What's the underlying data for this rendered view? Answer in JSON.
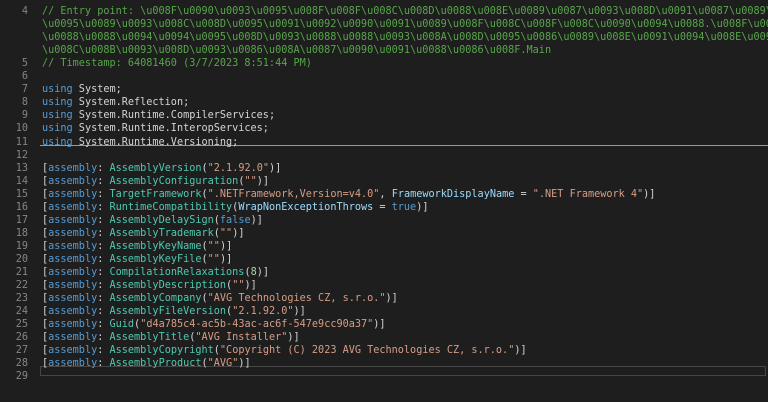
{
  "lines": [
    {
      "n": "4",
      "segs": [
        {
          "c": "comment",
          "t": "// Entry point: \\u008F\\u0090\\u0093\\u0095\\u008F\\u008F\\u008C\\u008D\\u0088\\u008E\\u0089\\u0087\\u0093\\u008D\\u0091\\u0087\\u0089\\u0094"
        }
      ]
    },
    {
      "n": "",
      "segs": [
        {
          "c": "comment",
          "t": "\\u0095\\u0089\\u0093\\u008C\\u008D\\u0095\\u0091\\u0092\\u0090\\u0091\\u0089\\u008F\\u008C\\u008F\\u008C\\u0090\\u0094\\u0088.\\u008F\\u0092"
        }
      ]
    },
    {
      "n": "",
      "segs": [
        {
          "c": "comment",
          "t": "\\u0088\\u0088\\u0094\\u0094\\u0095\\u008D\\u0093\\u0088\\u0088\\u0093\\u008A\\u008D\\u0095\\u0086\\u0089\\u008E\\u0091\\u0094\\u008E\\u0090"
        }
      ]
    },
    {
      "n": "",
      "segs": [
        {
          "c": "comment",
          "t": "\\u008C\\u008B\\u0093\\u008D\\u0093\\u0086\\u008A\\u0087\\u0090\\u0091\\u0088\\u0086\\u008F.Main"
        }
      ]
    },
    {
      "n": "5",
      "segs": [
        {
          "c": "comment",
          "t": "// Timestamp: 64081460 (3/7/2023 8:51:44 PM)"
        }
      ]
    },
    {
      "n": "6",
      "segs": []
    },
    {
      "n": "7",
      "segs": [
        {
          "c": "kw",
          "t": "using"
        },
        {
          "c": "ns",
          "t": " System;"
        }
      ]
    },
    {
      "n": "8",
      "segs": [
        {
          "c": "kw",
          "t": "using"
        },
        {
          "c": "ns",
          "t": " System.Reflection;"
        }
      ]
    },
    {
      "n": "9",
      "segs": [
        {
          "c": "kw",
          "t": "using"
        },
        {
          "c": "ns",
          "t": " System.Runtime.CompilerServices;"
        }
      ]
    },
    {
      "n": "10",
      "segs": [
        {
          "c": "kw",
          "t": "using"
        },
        {
          "c": "ns",
          "t": " System.Runtime.InteropServices;"
        }
      ]
    },
    {
      "n": "11",
      "segs": [
        {
          "c": "kw",
          "t": "using"
        },
        {
          "c": "ns",
          "t": " System.Runtime.Versioning;"
        }
      ]
    },
    {
      "n": "12",
      "segs": []
    },
    {
      "n": "13",
      "segs": [
        {
          "c": "punc",
          "t": "["
        },
        {
          "c": "attrkw",
          "t": "assembly"
        },
        {
          "c": "punc",
          "t": ": "
        },
        {
          "c": "attr",
          "t": "AssemblyVersion"
        },
        {
          "c": "punc",
          "t": "("
        },
        {
          "c": "str",
          "t": "\"2.1.92.0\""
        },
        {
          "c": "punc",
          "t": ")]"
        }
      ]
    },
    {
      "n": "14",
      "segs": [
        {
          "c": "punc",
          "t": "["
        },
        {
          "c": "attrkw",
          "t": "assembly"
        },
        {
          "c": "punc",
          "t": ": "
        },
        {
          "c": "attr",
          "t": "AssemblyConfiguration"
        },
        {
          "c": "punc",
          "t": "("
        },
        {
          "c": "str",
          "t": "\"\""
        },
        {
          "c": "punc",
          "t": ")]"
        }
      ]
    },
    {
      "n": "15",
      "segs": [
        {
          "c": "punc",
          "t": "["
        },
        {
          "c": "attrkw",
          "t": "assembly"
        },
        {
          "c": "punc",
          "t": ": "
        },
        {
          "c": "attr",
          "t": "TargetFramework"
        },
        {
          "c": "punc",
          "t": "("
        },
        {
          "c": "str",
          "t": "\".NETFramework,Version=v4.0\""
        },
        {
          "c": "punc",
          "t": ", "
        },
        {
          "c": "param",
          "t": "FrameworkDisplayName"
        },
        {
          "c": "punc",
          "t": " = "
        },
        {
          "c": "str",
          "t": "\".NET Framework 4\""
        },
        {
          "c": "punc",
          "t": ")]"
        }
      ]
    },
    {
      "n": "16",
      "segs": [
        {
          "c": "punc",
          "t": "["
        },
        {
          "c": "attrkw",
          "t": "assembly"
        },
        {
          "c": "punc",
          "t": ": "
        },
        {
          "c": "attr",
          "t": "RuntimeCompatibility"
        },
        {
          "c": "punc",
          "t": "("
        },
        {
          "c": "param",
          "t": "WrapNonExceptionThrows"
        },
        {
          "c": "punc",
          "t": " = "
        },
        {
          "c": "boolv",
          "t": "true"
        },
        {
          "c": "punc",
          "t": ")]"
        }
      ]
    },
    {
      "n": "17",
      "segs": [
        {
          "c": "punc",
          "t": "["
        },
        {
          "c": "attrkw",
          "t": "assembly"
        },
        {
          "c": "punc",
          "t": ": "
        },
        {
          "c": "attr",
          "t": "AssemblyDelaySign"
        },
        {
          "c": "punc",
          "t": "("
        },
        {
          "c": "boolv",
          "t": "false"
        },
        {
          "c": "punc",
          "t": ")]"
        }
      ]
    },
    {
      "n": "18",
      "segs": [
        {
          "c": "punc",
          "t": "["
        },
        {
          "c": "attrkw",
          "t": "assembly"
        },
        {
          "c": "punc",
          "t": ": "
        },
        {
          "c": "attr",
          "t": "AssemblyTrademark"
        },
        {
          "c": "punc",
          "t": "("
        },
        {
          "c": "str",
          "t": "\"\""
        },
        {
          "c": "punc",
          "t": ")]"
        }
      ]
    },
    {
      "n": "19",
      "segs": [
        {
          "c": "punc",
          "t": "["
        },
        {
          "c": "attrkw",
          "t": "assembly"
        },
        {
          "c": "punc",
          "t": ": "
        },
        {
          "c": "attr",
          "t": "AssemblyKeyName"
        },
        {
          "c": "punc",
          "t": "("
        },
        {
          "c": "str",
          "t": "\"\""
        },
        {
          "c": "punc",
          "t": ")]"
        }
      ]
    },
    {
      "n": "20",
      "segs": [
        {
          "c": "punc",
          "t": "["
        },
        {
          "c": "attrkw",
          "t": "assembly"
        },
        {
          "c": "punc",
          "t": ": "
        },
        {
          "c": "attr",
          "t": "AssemblyKeyFile"
        },
        {
          "c": "punc",
          "t": "("
        },
        {
          "c": "str",
          "t": "\"\""
        },
        {
          "c": "punc",
          "t": ")]"
        }
      ]
    },
    {
      "n": "21",
      "segs": [
        {
          "c": "punc",
          "t": "["
        },
        {
          "c": "attrkw",
          "t": "assembly"
        },
        {
          "c": "punc",
          "t": ": "
        },
        {
          "c": "attr",
          "t": "CompilationRelaxations"
        },
        {
          "c": "punc",
          "t": "("
        },
        {
          "c": "num",
          "t": "8"
        },
        {
          "c": "punc",
          "t": ")]"
        }
      ]
    },
    {
      "n": "22",
      "segs": [
        {
          "c": "punc",
          "t": "["
        },
        {
          "c": "attrkw",
          "t": "assembly"
        },
        {
          "c": "punc",
          "t": ": "
        },
        {
          "c": "attr",
          "t": "AssemblyDescription"
        },
        {
          "c": "punc",
          "t": "("
        },
        {
          "c": "str",
          "t": "\"\""
        },
        {
          "c": "punc",
          "t": ")]"
        }
      ]
    },
    {
      "n": "23",
      "segs": [
        {
          "c": "punc",
          "t": "["
        },
        {
          "c": "attrkw",
          "t": "assembly"
        },
        {
          "c": "punc",
          "t": ": "
        },
        {
          "c": "attr",
          "t": "AssemblyCompany"
        },
        {
          "c": "punc",
          "t": "("
        },
        {
          "c": "str",
          "t": "\"AVG Technologies CZ, s.r.o.\""
        },
        {
          "c": "punc",
          "t": ")]"
        }
      ]
    },
    {
      "n": "24",
      "segs": [
        {
          "c": "punc",
          "t": "["
        },
        {
          "c": "attrkw",
          "t": "assembly"
        },
        {
          "c": "punc",
          "t": ": "
        },
        {
          "c": "attr",
          "t": "AssemblyFileVersion"
        },
        {
          "c": "punc",
          "t": "("
        },
        {
          "c": "str",
          "t": "\"2.1.92.0\""
        },
        {
          "c": "punc",
          "t": ")]"
        }
      ]
    },
    {
      "n": "25",
      "segs": [
        {
          "c": "punc",
          "t": "["
        },
        {
          "c": "attrkw",
          "t": "assembly"
        },
        {
          "c": "punc",
          "t": ": "
        },
        {
          "c": "attr",
          "t": "Guid"
        },
        {
          "c": "punc",
          "t": "("
        },
        {
          "c": "str",
          "t": "\"d4a785c4-ac5b-43ac-ac6f-547e9cc90a37\""
        },
        {
          "c": "punc",
          "t": ")]"
        }
      ]
    },
    {
      "n": "26",
      "segs": [
        {
          "c": "punc",
          "t": "["
        },
        {
          "c": "attrkw",
          "t": "assembly"
        },
        {
          "c": "punc",
          "t": ": "
        },
        {
          "c": "attr",
          "t": "AssemblyTitle"
        },
        {
          "c": "punc",
          "t": "("
        },
        {
          "c": "str",
          "t": "\"AVG Installer\""
        },
        {
          "c": "punc",
          "t": ")]"
        }
      ]
    },
    {
      "n": "27",
      "segs": [
        {
          "c": "punc",
          "t": "["
        },
        {
          "c": "attrkw",
          "t": "assembly"
        },
        {
          "c": "punc",
          "t": ": "
        },
        {
          "c": "attr",
          "t": "AssemblyCopyright"
        },
        {
          "c": "punc",
          "t": "("
        },
        {
          "c": "str",
          "t": "\"Copyright (C) 2023 AVG Technologies CZ, s.r.o.\""
        },
        {
          "c": "punc",
          "t": ")]"
        }
      ]
    },
    {
      "n": "28",
      "segs": [
        {
          "c": "punc",
          "t": "["
        },
        {
          "c": "attrkw",
          "t": "assembly"
        },
        {
          "c": "punc",
          "t": ": "
        },
        {
          "c": "attr",
          "t": "AssemblyProduct"
        },
        {
          "c": "punc",
          "t": "("
        },
        {
          "c": "str",
          "t": "\"AVG\""
        },
        {
          "c": "punc",
          "t": ")]"
        }
      ]
    },
    {
      "n": "29",
      "segs": []
    }
  ],
  "colors": {
    "background": "#1e1e1e",
    "line_number": "#858585",
    "comment": "#57a64a",
    "keyword": "#569cd6",
    "type": "#4ec9b0",
    "string": "#d69d85",
    "number": "#b5cea8",
    "parameter": "#9cdcfe",
    "text": "#d4d4d4"
  }
}
